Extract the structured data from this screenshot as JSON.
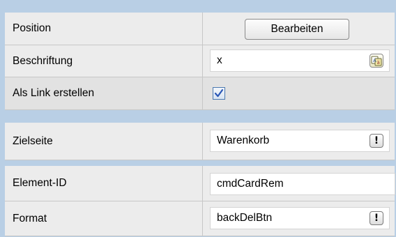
{
  "properties": {
    "position": {
      "label": "Position",
      "button_label": "Bearbeiten"
    },
    "beschriftung": {
      "label": "Beschriftung",
      "value": "x",
      "icon": "language-icon"
    },
    "als_link": {
      "label": "Als Link erstellen",
      "checked": true
    },
    "zielseite": {
      "label": "Zielseite",
      "value": "Warenkorb",
      "button_icon": "exclamation-icon"
    },
    "element_id": {
      "label": "Element-ID",
      "value": "cmdCardRem"
    },
    "format": {
      "label": "Format",
      "value": "backDelBtn",
      "button_icon": "exclamation-icon"
    }
  },
  "colors": {
    "background": "#b9cfe5",
    "row_background": "#ececec",
    "checkbox_border": "#4c7ab0",
    "checkmark": "#2a57b5"
  }
}
